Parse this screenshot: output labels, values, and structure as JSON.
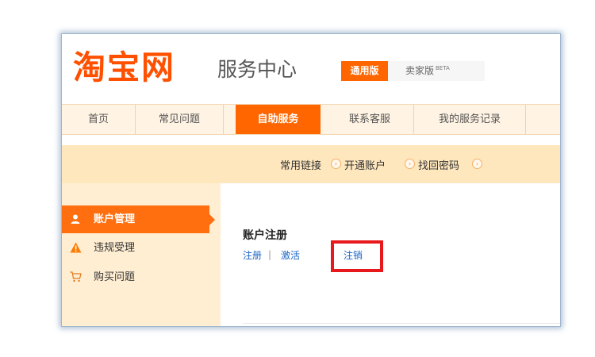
{
  "header": {
    "logo_text": "淘宝网",
    "service_title": "服务中心",
    "version_tabs": [
      {
        "label": "通用版",
        "active": true
      },
      {
        "label": "卖家版",
        "badge": "BETA",
        "active": false
      }
    ]
  },
  "nav": {
    "items": [
      {
        "label": "首页",
        "active": false
      },
      {
        "label": "常见问题",
        "active": false
      },
      {
        "label": "自助服务",
        "active": true
      },
      {
        "label": "联系客服",
        "active": false
      },
      {
        "label": "我的服务记录",
        "active": false
      }
    ]
  },
  "quick_links": {
    "label": "常用链接",
    "links": [
      "开通账户",
      "找回密码"
    ]
  },
  "sidebar": {
    "items": [
      {
        "label": "账户管理",
        "icon": "user-icon",
        "active": true
      },
      {
        "label": "违规受理",
        "icon": "warning-icon",
        "active": false
      },
      {
        "label": "购买问题",
        "icon": "cart-icon",
        "active": false
      }
    ]
  },
  "content": {
    "title": "账户注册",
    "links": [
      "注册",
      "激活",
      "注销"
    ],
    "highlighted_link": "注销"
  },
  "colors": {
    "brand_orange": "#ff6600",
    "highlight_red": "#e8191c",
    "link_blue": "#1a63c4"
  }
}
